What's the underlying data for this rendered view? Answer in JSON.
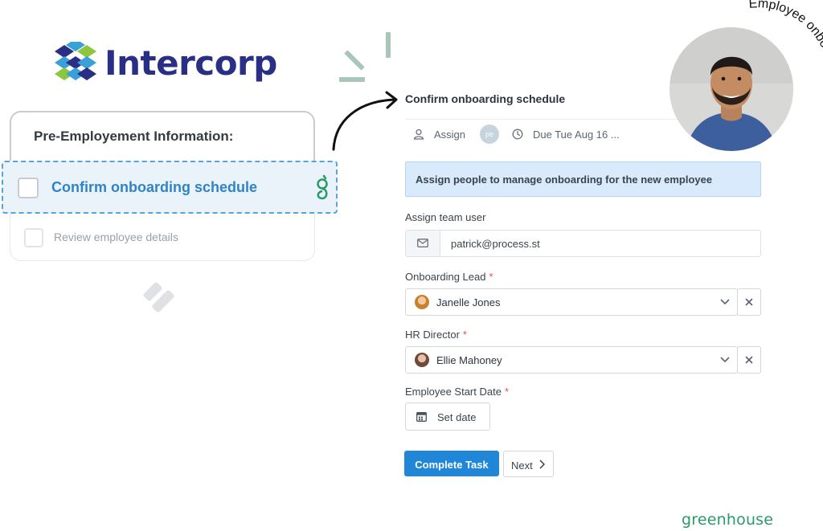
{
  "brand": {
    "name": "Intercorp"
  },
  "checklist": {
    "title": "Pre-Employement Information:",
    "active_item": "Confirm onboarding schedule",
    "items": [
      {
        "label": "Review employee details"
      }
    ]
  },
  "task": {
    "title": "Confirm onboarding schedule",
    "assign_label": "Assign",
    "assignee_initials": "pe",
    "due_label": "Due Tue Aug 16 ...",
    "banner": "Assign people to manage onboarding for the new employee"
  },
  "form": {
    "team_user": {
      "label": "Assign team user",
      "value": "patrick@process.st"
    },
    "onboarding_lead": {
      "label": "Onboarding Lead",
      "value": "Janelle Jones"
    },
    "hr_director": {
      "label": "HR Director",
      "value": "Ellie Mahoney"
    },
    "start_date": {
      "label": "Employee Start Date",
      "button": "Set date"
    },
    "required_mark": "*"
  },
  "actions": {
    "complete": "Complete Task",
    "next": "Next"
  },
  "badge": {
    "curved_text": "Employee onboarding"
  },
  "partner": {
    "name": "greenhouse"
  },
  "colors": {
    "brand": "#2a2f86",
    "accent": "#1f86d8",
    "active_text": "#2f84c7",
    "greenhouse": "#2a9a6b"
  }
}
